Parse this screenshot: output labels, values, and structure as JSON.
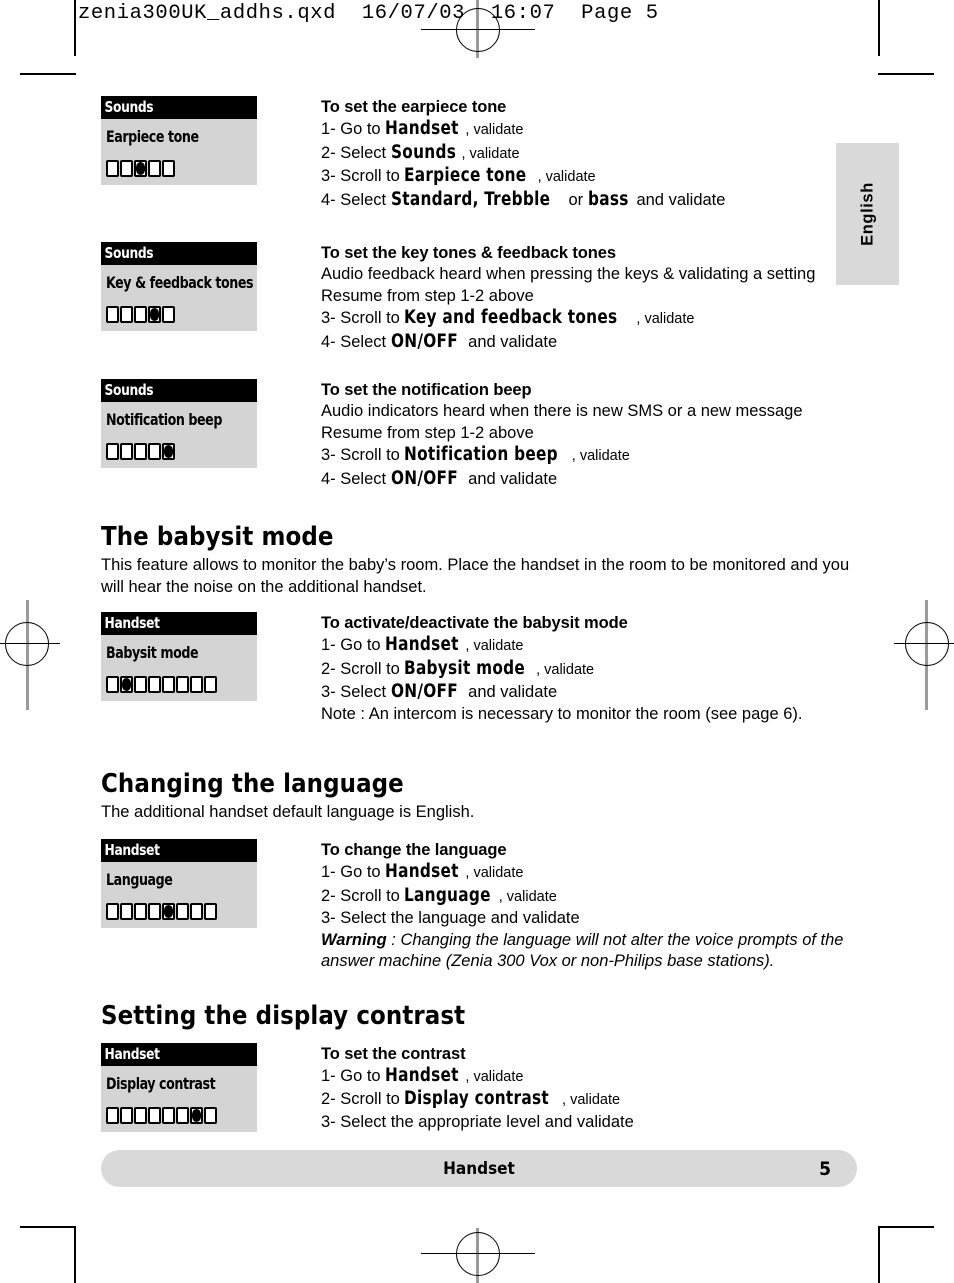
{
  "prepress": {
    "header": "zenia300UK_addhs.qxd  16/07/03  16:07  Page 5"
  },
  "side_tab": {
    "label": "English"
  },
  "footer": {
    "title": "Handset",
    "page_number": "5"
  },
  "sections": [
    {
      "lcd": {
        "title": "Sounds",
        "label": "Earpiece tone",
        "dots_total": 5,
        "dots_filled_index": 3
      },
      "heading": "To set the earpiece tone",
      "lines": [
        {
          "prefix": "1- Go to ",
          "menu": "Handset",
          "suffix": ", validate"
        },
        {
          "prefix": "2- Select ",
          "menu": "Sounds",
          "suffix": ", validate"
        },
        {
          "prefix": "3- Scroll to ",
          "menu": "Earpiece tone",
          "suffix": ", validate"
        },
        {
          "prefix": "4- Select ",
          "menu": "Standard, Trebble",
          "mid": " or ",
          "menu2": "bass",
          "suffix": " and validate"
        }
      ]
    },
    {
      "lcd": {
        "title": "Sounds",
        "label": "Key & feedback tones",
        "dots_total": 5,
        "dots_filled_index": 4
      },
      "heading": "To set the key tones & feedback tones",
      "notes": [
        "Audio feedback heard when pressing the keys & validating a setting",
        "Resume from step 1-2 above"
      ],
      "lines": [
        {
          "prefix": "3- Scroll to ",
          "menu": "Key and feedback tones",
          "suffix": ", validate"
        },
        {
          "prefix": "4- Select ",
          "menu": "ON/OFF",
          "suffix": " and validate"
        }
      ]
    },
    {
      "lcd": {
        "title": "Sounds",
        "label": "Notification beep",
        "dots_total": 5,
        "dots_filled_index": 5
      },
      "heading": "To set the notification beep",
      "notes": [
        "Audio indicators heard when there is new SMS or a new message",
        "Resume from step 1-2 above"
      ],
      "lines": [
        {
          "prefix": "3- Scroll to ",
          "menu": "Notification beep",
          "suffix": ", validate"
        },
        {
          "prefix": "4- Select ",
          "menu": "ON/OFF",
          "suffix": " and validate"
        }
      ]
    }
  ],
  "babysit": {
    "heading": "The babysit mode",
    "intro": "This feature allows to monitor the baby’s room. Place the handset in the room to be monitored and you will hear the noise on the additional handset.",
    "lcd": {
      "title": "Handset",
      "label": "Babysit mode",
      "dots_total": 8,
      "dots_filled_index": 2
    },
    "sub_heading": "To activate/deactivate the babysit mode",
    "lines": [
      {
        "prefix": "1- Go to ",
        "menu": "Handset",
        "suffix": ", validate"
      },
      {
        "prefix": "2- Scroll to ",
        "menu": "Babysit mode",
        "suffix": ", validate"
      },
      {
        "prefix": "3- Select ",
        "menu": "ON/OFF",
        "suffix": " and validate"
      }
    ],
    "note": "Note : An intercom is necessary to monitor the room (see page 6)."
  },
  "language": {
    "heading": "Changing the language",
    "intro": "The additional handset default language is English.",
    "lcd": {
      "title": "Handset",
      "label": "Language",
      "dots_total": 8,
      "dots_filled_index": 5
    },
    "sub_heading": "To change the language",
    "lines": [
      {
        "prefix": "1- Go to ",
        "menu": "Handset",
        "suffix": ", validate"
      },
      {
        "prefix": "2- Scroll to ",
        "menu": "Language",
        "suffix": ", validate"
      },
      {
        "prefix": "3- Select the language and validate",
        "menu": "",
        "suffix": ""
      }
    ],
    "warning_label": "Warning",
    "warning_text": " : Changing the language will not alter the voice prompts of the answer machine (Zenia 300 Vox or non-Philips base stations)."
  },
  "contrast": {
    "heading": "Setting the display contrast",
    "lcd": {
      "title": "Handset",
      "label": "Display contrast",
      "dots_total": 8,
      "dots_filled_index": 7
    },
    "sub_heading": "To set the contrast",
    "lines": [
      {
        "prefix": "1- Go to ",
        "menu": "Handset",
        "suffix": ", validate"
      },
      {
        "prefix": "2- Scroll to ",
        "menu": "Display contrast",
        "suffix": ", validate"
      },
      {
        "prefix": "3- Select the appropriate level and validate",
        "menu": "",
        "suffix": ""
      }
    ]
  },
  "colors": {
    "lcd_background": "#d4d4d4",
    "lcd_titlebar": "#000000",
    "tab_background": "#d9d9d9",
    "footer_background": "#d9d9d9"
  }
}
